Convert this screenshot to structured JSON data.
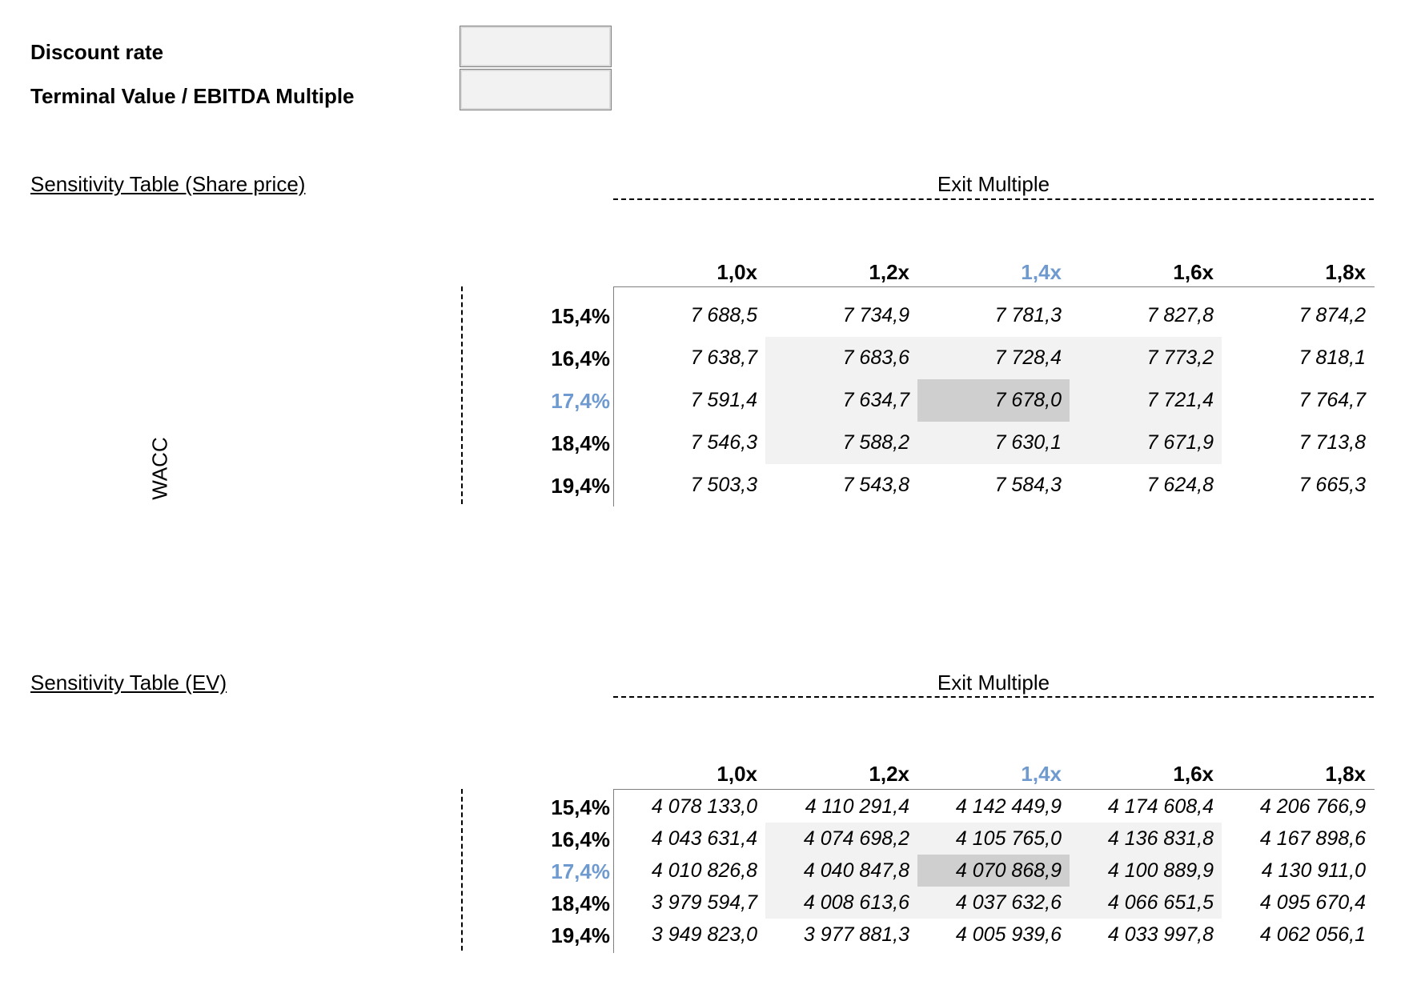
{
  "inputs": {
    "discount_rate_label": "Discount rate",
    "terminal_multiple_label": "Terminal Value / EBITDA Multiple"
  },
  "colors": {
    "base_case": "#6f9ad0",
    "highlight_light": "#f2f2f2",
    "highlight_dark": "#cfcfcf"
  },
  "share_table": {
    "title": "Sensitivity Table (Share price)",
    "exit_label": "Exit Multiple",
    "wacc_label": "WACC",
    "col_headers": [
      "1,0x",
      "1,2x",
      "1,4x",
      "1,6x",
      "1,8x"
    ],
    "row_headers": [
      "15,4%",
      "16,4%",
      "17,4%",
      "18,4%",
      "19,4%"
    ],
    "rows": [
      [
        "7 688,5",
        "7 734,9",
        "7 781,3",
        "7 827,8",
        "7 874,2"
      ],
      [
        "7 638,7",
        "7 683,6",
        "7 728,4",
        "7 773,2",
        "7 818,1"
      ],
      [
        "7 591,4",
        "7 634,7",
        "7 678,0",
        "7 721,4",
        "7 764,7"
      ],
      [
        "7 546,3",
        "7 588,2",
        "7 630,1",
        "7 671,9",
        "7 713,8"
      ],
      [
        "7 503,3",
        "7 543,8",
        "7 584,3",
        "7 624,8",
        "7 665,3"
      ]
    ]
  },
  "ev_table": {
    "title": "Sensitivity Table (EV)",
    "exit_label": "Exit Multiple",
    "col_headers": [
      "1,0x",
      "1,2x",
      "1,4x",
      "1,6x",
      "1,8x"
    ],
    "row_headers": [
      "15,4%",
      "16,4%",
      "17,4%",
      "18,4%",
      "19,4%"
    ],
    "rows": [
      [
        "4 078 133,0",
        "4 110 291,4",
        "4 142 449,9",
        "4 174 608,4",
        "4 206 766,9"
      ],
      [
        "4 043 631,4",
        "4 074 698,2",
        "4 105 765,0",
        "4 136 831,8",
        "4 167 898,6"
      ],
      [
        "4 010 826,8",
        "4 040 847,8",
        "4 070 868,9",
        "4 100 889,9",
        "4 130 911,0"
      ],
      [
        "3 979 594,7",
        "4 008 613,6",
        "4 037 632,6",
        "4 066 651,5",
        "4 095 670,4"
      ],
      [
        "3 949 823,0",
        "3 977 881,3",
        "4 005 939,6",
        "4 033 997,8",
        "4 062 056,1"
      ]
    ]
  }
}
